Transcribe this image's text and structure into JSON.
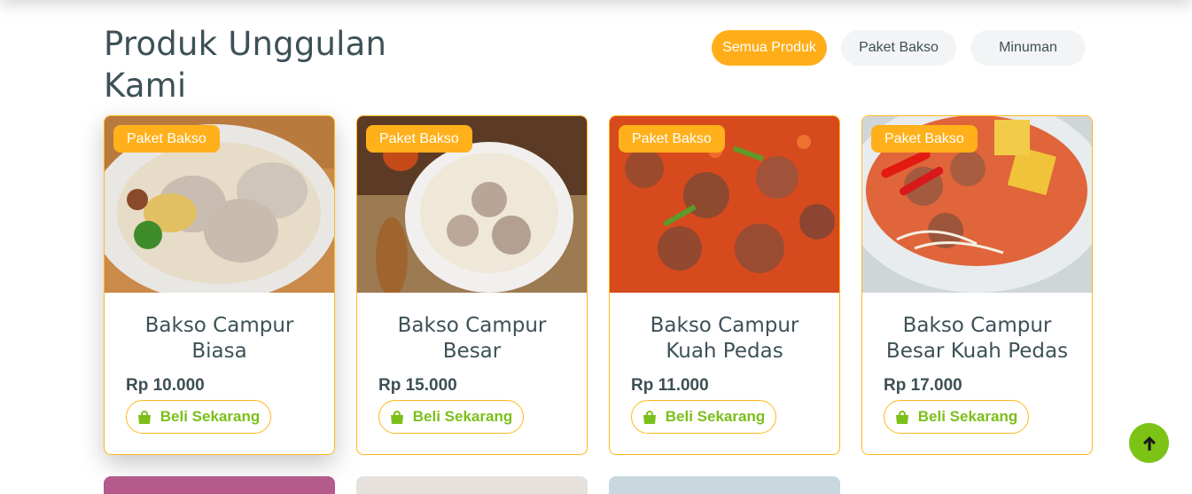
{
  "section": {
    "title": "Produk Unggulan Kami"
  },
  "filters": [
    {
      "label": "Semua Produk",
      "active": true
    },
    {
      "label": "Paket Bakso",
      "active": false
    },
    {
      "label": "Minuman",
      "active": false
    }
  ],
  "products": [
    {
      "badge": "Paket Bakso",
      "name": "Bakso Campur Biasa",
      "price": "Rp 10.000",
      "button": "Beli Sekarang"
    },
    {
      "badge": "Paket Bakso",
      "name": "Bakso Campur Besar",
      "price": "Rp 15.000",
      "button": "Beli Sekarang"
    },
    {
      "badge": "Paket Bakso",
      "name": "Bakso Campur Kuah Pedas",
      "price": "Rp 11.000",
      "button": "Beli Sekarang"
    },
    {
      "badge": "Paket Bakso",
      "name": "Bakso Campur Besar Kuah Pedas",
      "price": "Rp 17.000",
      "button": "Beli Sekarang"
    }
  ],
  "colors": {
    "accent": "#ffae1a",
    "button_text": "#7cbf1a",
    "scroll_button": "#7cc316",
    "heading": "#3d5157"
  },
  "icons": {
    "buy": "shopping-bag-icon",
    "scroll_top": "arrow-up-icon"
  }
}
